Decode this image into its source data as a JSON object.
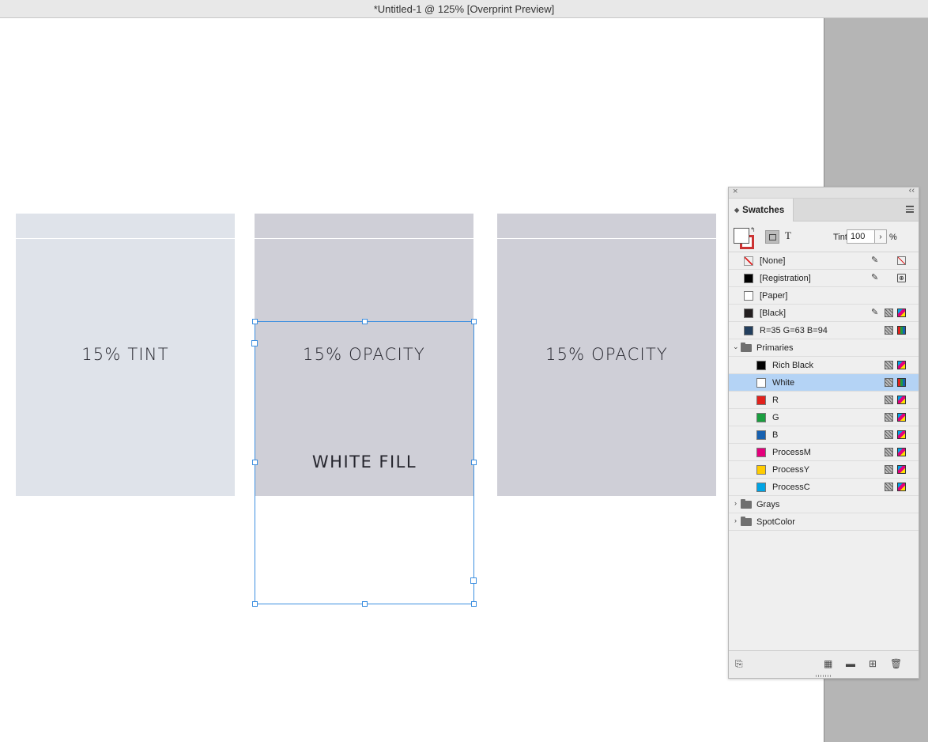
{
  "window": {
    "title": "*Untitled-1 @ 125% [Overprint Preview]"
  },
  "document": {
    "boxes": [
      {
        "label": "15% TINT",
        "fill": "#dfe3ea"
      },
      {
        "label": "15% OPACITY",
        "fill": "#cfcfd7"
      },
      {
        "label": "15% OPACITY",
        "fill": "#cfcfd7"
      }
    ],
    "white_fill_label": "WHITE FILL"
  },
  "swatches_panel": {
    "tab_label": "Swatches",
    "tint_label": "Tint:",
    "tint_value": "100",
    "tint_unit": "%",
    "text_button": "T",
    "items": [
      {
        "name": "[None]",
        "color": "none"
      },
      {
        "name": "[Registration]",
        "color": "#000000"
      },
      {
        "name": "[Paper]",
        "color": "#ffffff"
      },
      {
        "name": "[Black]",
        "color": "#231f20"
      },
      {
        "name": "R=35 G=63 B=94",
        "color": "#233f5e"
      }
    ],
    "groups": [
      {
        "name": "Primaries",
        "expanded": true,
        "items": [
          {
            "name": "Rich Black",
            "color": "#000000"
          },
          {
            "name": "White",
            "color": "#ffffff",
            "selected": true
          },
          {
            "name": "R",
            "color": "#e2211c"
          },
          {
            "name": "G",
            "color": "#1a9e3f"
          },
          {
            "name": "B",
            "color": "#1761b0"
          },
          {
            "name": "ProcessM",
            "color": "#e4007c"
          },
          {
            "name": "ProcessY",
            "color": "#ffcc00"
          },
          {
            "name": "ProcessC",
            "color": "#00a4e4"
          }
        ]
      },
      {
        "name": "Grays",
        "expanded": false
      },
      {
        "name": "SpotColor",
        "expanded": false
      }
    ]
  }
}
